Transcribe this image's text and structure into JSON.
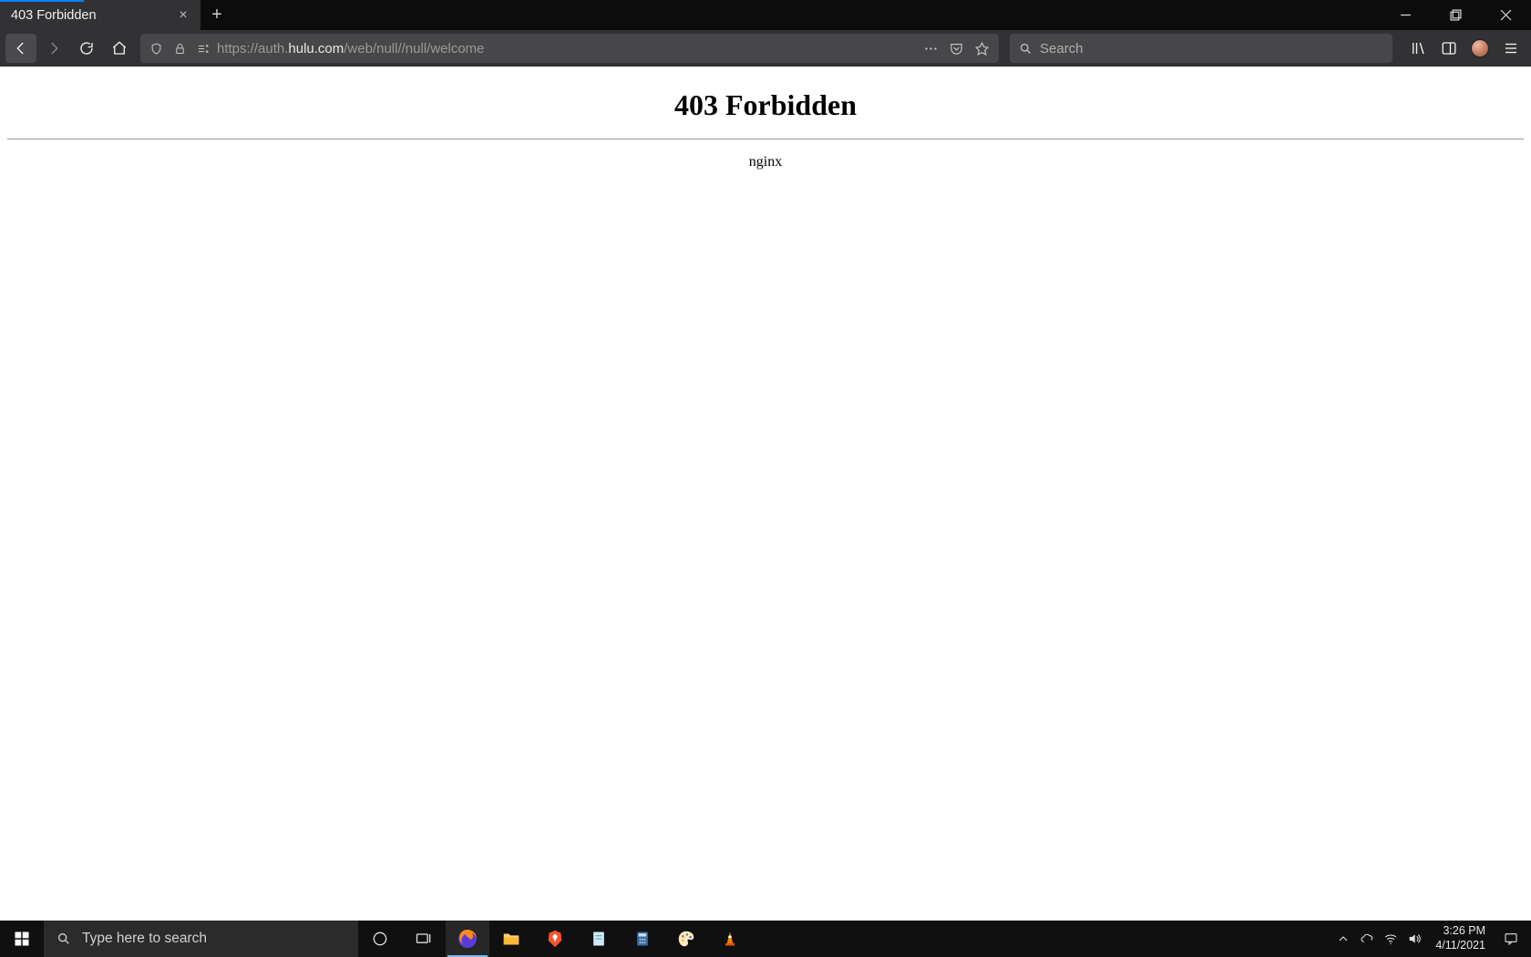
{
  "browser": {
    "tab_title": "403 Forbidden",
    "url_prefix": "https://auth.",
    "url_host": "hulu.com",
    "url_path": "/web/null//null/welcome",
    "search_placeholder": "Search"
  },
  "page": {
    "heading": "403 Forbidden",
    "server": "nginx"
  },
  "taskbar": {
    "search_placeholder": "Type here to search",
    "time": "3:26 PM",
    "date": "4/11/2021"
  }
}
